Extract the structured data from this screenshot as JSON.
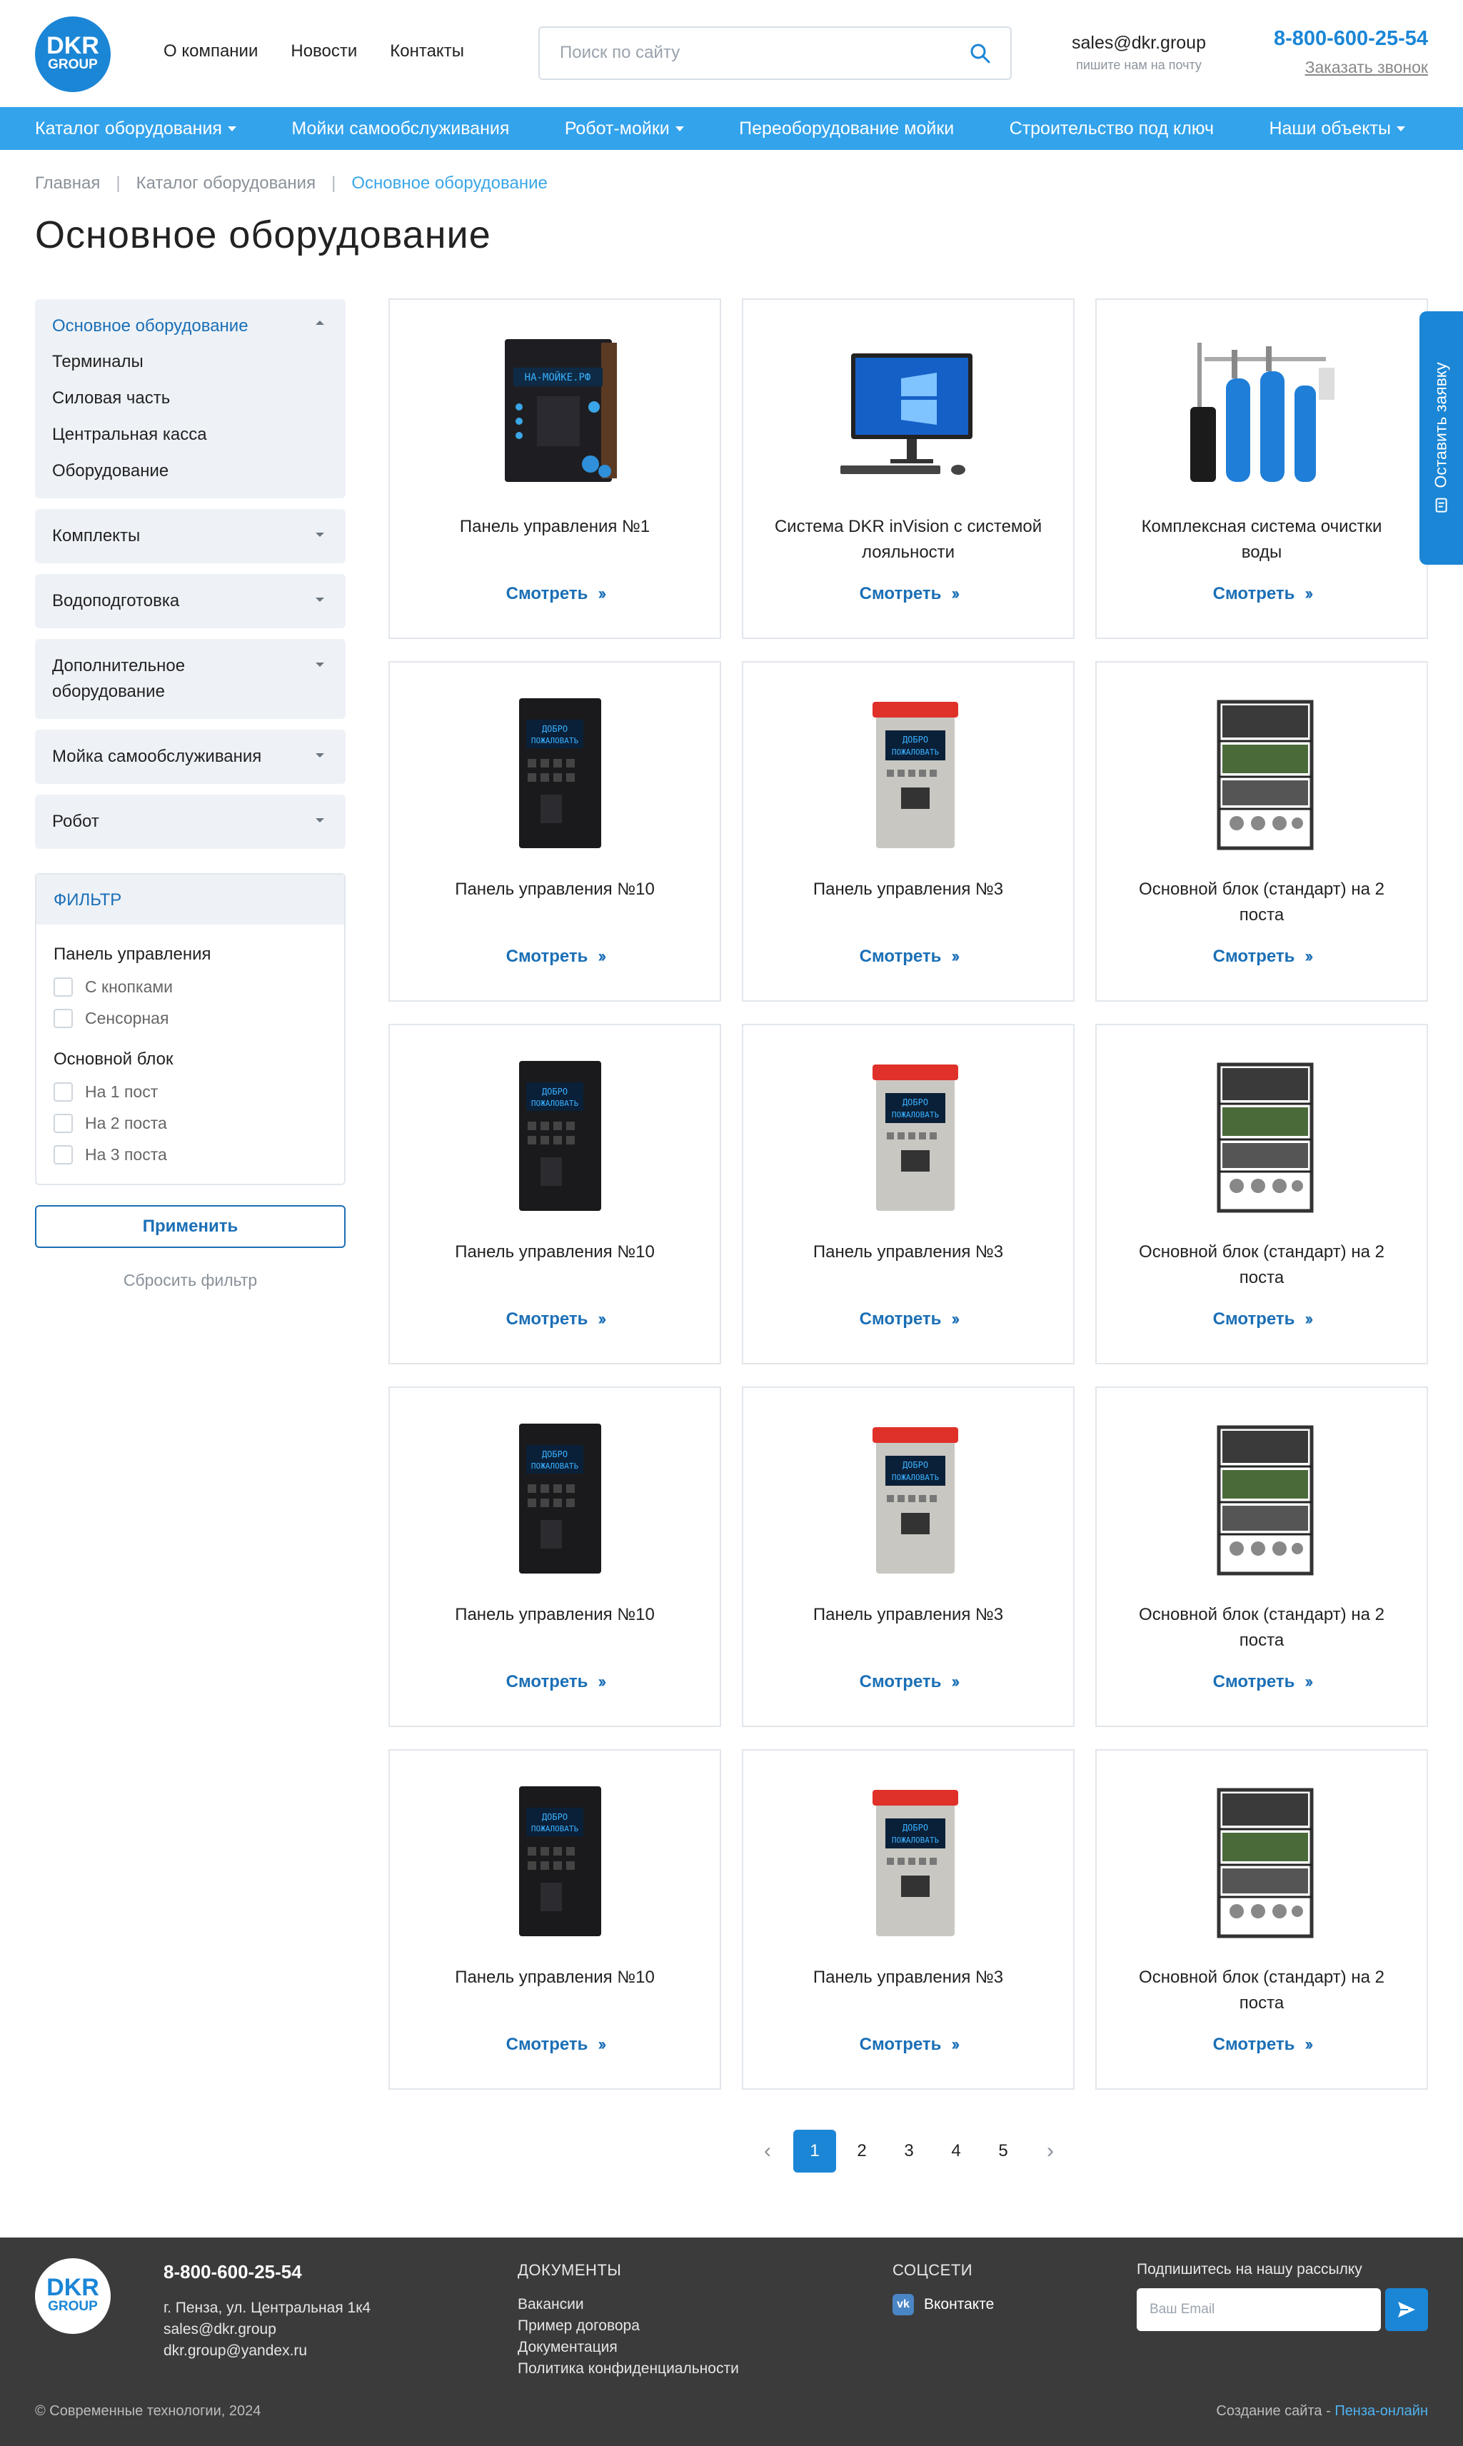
{
  "header": {
    "logo_top": "DKR",
    "logo_bottom": "GROUP",
    "nav": [
      "О компании",
      "Новости",
      "Контакты"
    ],
    "search_placeholder": "Поиск по сайту",
    "email": "sales@dkr.group",
    "email_caption": "пишите нам на почту",
    "phone": "8-800-600-25-54",
    "callback": "Заказать звонок"
  },
  "menu": [
    {
      "label": "Каталог оборудования",
      "dropdown": true
    },
    {
      "label": "Мойки самообслуживания",
      "dropdown": false
    },
    {
      "label": "Робот-мойки",
      "dropdown": true
    },
    {
      "label": "Переоборудование мойки",
      "dropdown": false
    },
    {
      "label": "Строительство под ключ",
      "dropdown": false
    },
    {
      "label": "Наши объекты",
      "dropdown": true
    }
  ],
  "breadcrumb": [
    "Главная",
    "Каталог оборудования",
    "Основное оборудование"
  ],
  "page_title": "Основное оборудование",
  "sidebar": {
    "open_category": {
      "title": "Основное оборудование",
      "items": [
        "Терминалы",
        "Силовая часть",
        "Центральная касса",
        "Оборудование"
      ]
    },
    "categories": [
      "Комплекты",
      "Водоподготовка",
      "Дополнительное оборудование",
      "Мойка самообслуживания",
      "Робот"
    ],
    "filter": {
      "title": "ФИЛЬТР",
      "group1": "Панель управления",
      "group1_options": [
        "С кнопками",
        "Сенсорная"
      ],
      "group2": "Основной блок",
      "group2_options": [
        "На 1 пост",
        "На 2 поста",
        "На 3 поста"
      ],
      "apply": "Применить",
      "reset": "Сбросить фильтр"
    }
  },
  "products": [
    {
      "name": "Панель управления №1",
      "icon": "panel-wide"
    },
    {
      "name": "Система DKR inVision с системой лояльности",
      "icon": "monitor"
    },
    {
      "name": "Комплексная система очистки воды",
      "icon": "water-filter"
    },
    {
      "name": "Панель управления №10",
      "icon": "panel-dark"
    },
    {
      "name": "Панель управления №3",
      "icon": "panel-silver"
    },
    {
      "name": "Основной блок (стандарт) на 2 поста",
      "icon": "rack"
    },
    {
      "name": "Панель управления №10",
      "icon": "panel-dark"
    },
    {
      "name": "Панель управления №3",
      "icon": "panel-silver"
    },
    {
      "name": "Основной блок (стандарт) на 2 поста",
      "icon": "rack"
    },
    {
      "name": "Панель управления №10",
      "icon": "panel-dark"
    },
    {
      "name": "Панель управления №3",
      "icon": "panel-silver"
    },
    {
      "name": "Основной блок (стандарт) на 2 поста",
      "icon": "rack"
    },
    {
      "name": "Панель управления №10",
      "icon": "panel-dark"
    },
    {
      "name": "Панель управления №3",
      "icon": "panel-silver"
    },
    {
      "name": "Основной блок (стандарт) на 2 поста",
      "icon": "rack"
    }
  ],
  "more_label": "Смотреть",
  "pagination": {
    "pages": [
      "1",
      "2",
      "3",
      "4",
      "5"
    ],
    "current": "1",
    "prev": "‹",
    "next": "›"
  },
  "side_tab": "Оставить заявку",
  "footer": {
    "phone": "8-800-600-25-54",
    "address": "г. Пенза, ул. Центральная 1к4",
    "email1": "sales@dkr.group",
    "email2": "dkr.group@yandex.ru",
    "docs_title": "ДОКУМЕНТЫ",
    "docs": [
      "Вакансии",
      "Пример договора",
      "Документация",
      "Политика конфиденциальности"
    ],
    "social_title": "СОЦСЕТИ",
    "social": "Вконтакте",
    "subscribe_title": "Подпишитесь на нашу рассылку",
    "email_placeholder": "Ваш Email",
    "copyright": "© Современные технологии, 2024",
    "made_by": "Создание сайта - ",
    "made_by_link": "Пенза-онлайн"
  },
  "colors": {
    "accent": "#1b86d6",
    "menu": "#33a3ec",
    "link": "#1b6fb6",
    "footer": "#3b3b3b"
  }
}
